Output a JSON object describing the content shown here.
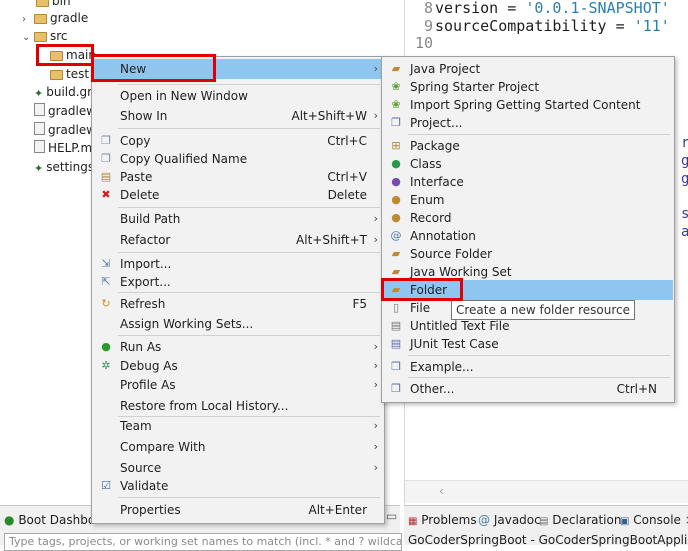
{
  "explorer": {
    "items": [
      {
        "label": "bin",
        "type": "folder"
      },
      {
        "label": "gradle",
        "type": "folder"
      },
      {
        "label": "src",
        "type": "folder"
      },
      {
        "label": "main",
        "type": "folder"
      },
      {
        "label": "test",
        "type": "folder"
      },
      {
        "label": "build.gra",
        "type": "gradle"
      },
      {
        "label": "gradlew",
        "type": "file"
      },
      {
        "label": "gradlew",
        "type": "file"
      },
      {
        "label": "HELP.m",
        "type": "file"
      },
      {
        "label": "settings",
        "type": "gradle"
      }
    ]
  },
  "editor": {
    "lines": [
      {
        "num": "8",
        "key": "version = ",
        "str": "'0.0.1-SNAPSHOT'"
      },
      {
        "num": "9",
        "key": "sourceCompatibility = ",
        "str": "'11'"
      },
      {
        "num": "10",
        "key": "",
        "str": ""
      }
    ],
    "edge_fragments": [
      "r",
      "g",
      "g",
      "s",
      "a"
    ]
  },
  "context_menu": {
    "items": [
      {
        "label": "New",
        "accel": "",
        "submenu": true
      },
      {
        "label": "Open in New Window",
        "accel": "",
        "submenu": false
      },
      {
        "label": "Show In",
        "accel": "Alt+Shift+W",
        "submenu": true
      },
      {
        "label": "Copy",
        "accel": "Ctrl+C",
        "submenu": false
      },
      {
        "label": "Copy Qualified Name",
        "accel": "",
        "submenu": false
      },
      {
        "label": "Paste",
        "accel": "Ctrl+V",
        "submenu": false
      },
      {
        "label": "Delete",
        "accel": "Delete",
        "submenu": false
      },
      {
        "label": "Build Path",
        "accel": "",
        "submenu": true
      },
      {
        "label": "Refactor",
        "accel": "Alt+Shift+T",
        "submenu": true
      },
      {
        "label": "Import...",
        "accel": "",
        "submenu": false
      },
      {
        "label": "Export...",
        "accel": "",
        "submenu": false
      },
      {
        "label": "Refresh",
        "accel": "F5",
        "submenu": false
      },
      {
        "label": "Assign Working Sets...",
        "accel": "",
        "submenu": false
      },
      {
        "label": "Run As",
        "accel": "",
        "submenu": true
      },
      {
        "label": "Debug As",
        "accel": "",
        "submenu": true
      },
      {
        "label": "Profile As",
        "accel": "",
        "submenu": true
      },
      {
        "label": "Restore from Local History...",
        "accel": "",
        "submenu": false
      },
      {
        "label": "Team",
        "accel": "",
        "submenu": true
      },
      {
        "label": "Compare With",
        "accel": "",
        "submenu": true
      },
      {
        "label": "Source",
        "accel": "",
        "submenu": true
      },
      {
        "label": "Validate",
        "accel": "",
        "submenu": false
      },
      {
        "label": "Properties",
        "accel": "Alt+Enter",
        "submenu": false
      }
    ]
  },
  "new_submenu": {
    "items": [
      {
        "label": "Java Project",
        "accel": ""
      },
      {
        "label": "Spring Starter Project",
        "accel": ""
      },
      {
        "label": "Import Spring Getting Started Content",
        "accel": ""
      },
      {
        "label": "Project...",
        "accel": ""
      },
      {
        "label": "Package",
        "accel": ""
      },
      {
        "label": "Class",
        "accel": ""
      },
      {
        "label": "Interface",
        "accel": ""
      },
      {
        "label": "Enum",
        "accel": ""
      },
      {
        "label": "Record",
        "accel": ""
      },
      {
        "label": "Annotation",
        "accel": ""
      },
      {
        "label": "Source Folder",
        "accel": ""
      },
      {
        "label": "Java Working Set",
        "accel": ""
      },
      {
        "label": "Folder",
        "accel": ""
      },
      {
        "label": "File",
        "accel": ""
      },
      {
        "label": "Untitled Text File",
        "accel": ""
      },
      {
        "label": "JUnit Test Case",
        "accel": ""
      },
      {
        "label": "Example...",
        "accel": ""
      },
      {
        "label": "Other...",
        "accel": "Ctrl+N"
      }
    ]
  },
  "tooltip": "Create a new folder resource",
  "boot_dashboard": {
    "title": "Boot Dashboard",
    "filter_placeholder": "Type tags, projects, or working set names to match (incl. * and ? wildca"
  },
  "bottom_tabs": {
    "problems": "Problems",
    "javadoc": "Javadoc",
    "declaration": "Declaration",
    "console": "Console"
  },
  "console_line": "GoCoderSpringBoot - GoCoderSpringBootApplicati",
  "colors": {
    "highlight": "#8fc6f0",
    "annotation_red": "#e00000",
    "string": "#2a7fb8"
  }
}
